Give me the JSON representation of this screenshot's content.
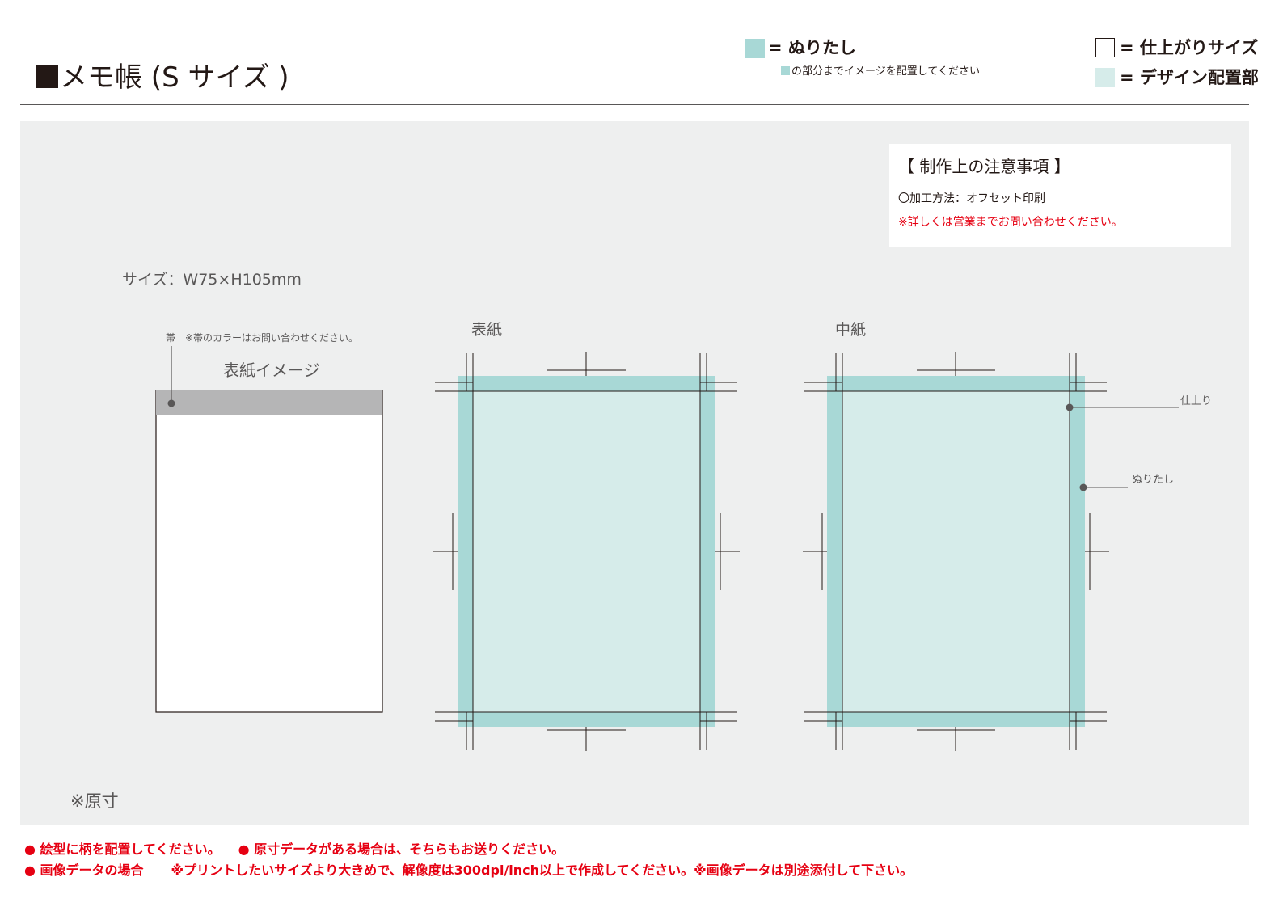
{
  "title": "メモ帳 (S サイズ )",
  "legend": {
    "bleed_label": "= ぬりたし",
    "bleed_note": "の部分までイメージを配置してください",
    "trim_label": "= 仕上がりサイズ",
    "design_label": "= デザイン配置部"
  },
  "colors": {
    "bleed": "#a8d8d6",
    "design_area": "#d6ecea",
    "band": "#b5b5b6",
    "panel_bg": "#eeefef",
    "warning": "#e60012"
  },
  "notes": {
    "heading": "【 制作上の注意事項 】",
    "method": "〇加工方法：オフセット印刷",
    "contact": "※詳しくは営業までお問い合わせください。"
  },
  "size_label": "サイズ：W75×H105mm",
  "cover_image": {
    "band_note": "帯　※帯のカラーはお問い合わせください。",
    "label": "表紙イメージ"
  },
  "templates": {
    "cover_label": "表紙",
    "inner_label": "中紙",
    "trim_callout": "仕上り",
    "bleed_callout": "ぬりたし"
  },
  "actual_size_note": "※原寸",
  "footer": {
    "note1": "● 絵型に柄を配置してください。",
    "note2": "● 原寸データがある場合は、そちらもお送りください。",
    "note3": "● 画像データの場合",
    "note4": "※プリントしたいサイズより大きめで、解像度は300dpi/inch以上で作成してください。※画像データは別途添付して下さい。"
  }
}
